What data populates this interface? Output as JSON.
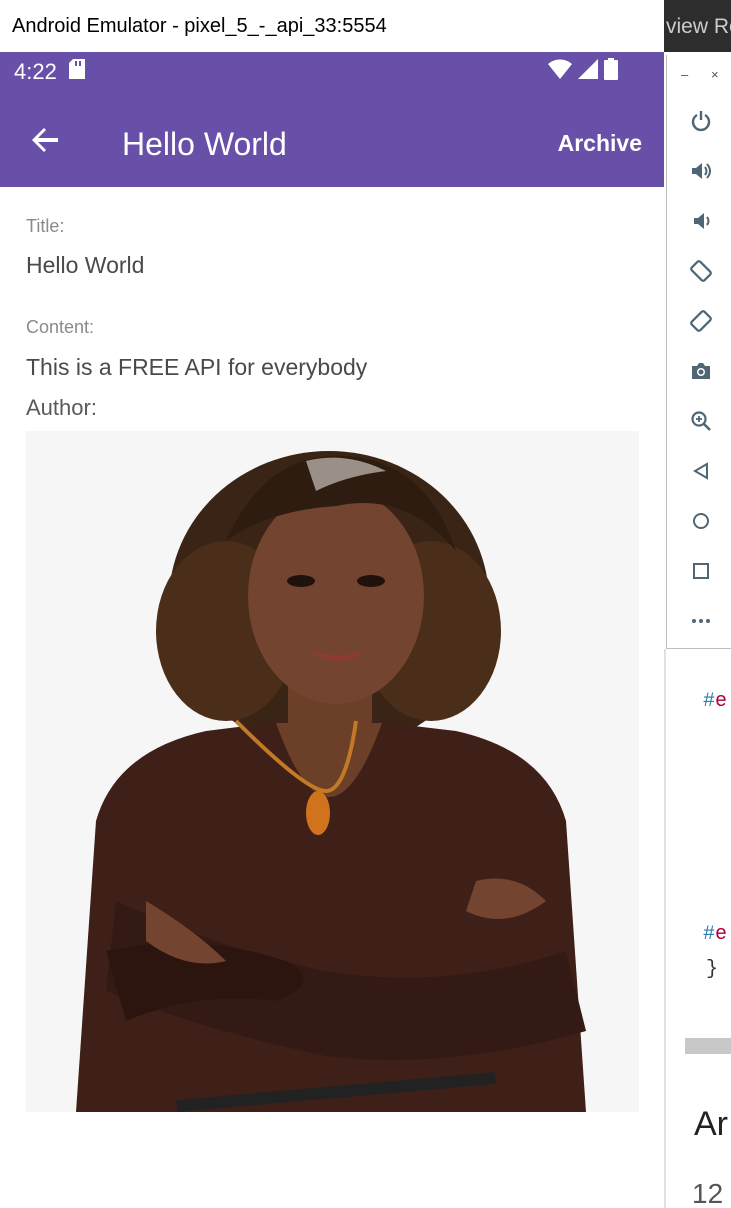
{
  "window": {
    "title": "Android Emulator - pixel_5_-_api_33:5554"
  },
  "background_app": {
    "tab_fragment": "view Re"
  },
  "status_bar": {
    "time": "4:22"
  },
  "app_bar": {
    "title": "Hello World",
    "archive_label": "Archive"
  },
  "post": {
    "title_label": "Title:",
    "title_value": "Hello World",
    "content_label": "Content:",
    "content_value": "This is a FREE API for everybody",
    "author_label": "Author:"
  },
  "emulator_toolbar": {
    "minimize": "–",
    "close": "×",
    "items": [
      "power-icon",
      "volume-up-icon",
      "volume-down-icon",
      "rotate-left-icon",
      "rotate-right-icon",
      "camera-icon",
      "zoom-icon",
      "back-icon",
      "home-icon",
      "overview-icon",
      "more-icon"
    ]
  },
  "editor": {
    "code_line1": "#e",
    "code_line2": "#e",
    "code_line3": "}",
    "heading_fragment": "Ar",
    "number_fragment": "12"
  },
  "colors": {
    "app_bar": "#6850a8",
    "text_label": "#8a8a8a",
    "text_value": "#4a4a4a"
  }
}
